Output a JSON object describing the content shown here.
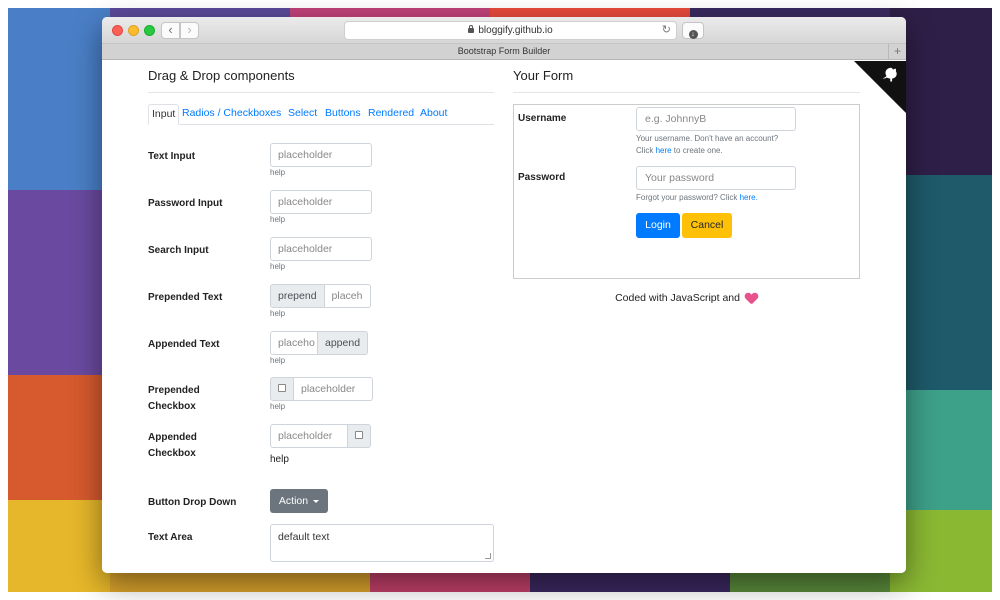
{
  "browser": {
    "url": "bloggify.github.io",
    "tab_title": "Bootstrap Form Builder",
    "back_label": "‹",
    "forward_label": "›",
    "reload_label": "↻",
    "download_label": "↓",
    "new_tab_label": "+"
  },
  "left": {
    "title": "Drag & Drop components",
    "tabs": [
      {
        "label": "Input",
        "active": true
      },
      {
        "label": "Radios / Checkboxes"
      },
      {
        "label": "Select"
      },
      {
        "label": "Buttons"
      },
      {
        "label": "Rendered"
      },
      {
        "label": "About"
      }
    ],
    "components": {
      "text_input": {
        "label": "Text Input",
        "placeholder": "placeholder",
        "help": "help"
      },
      "password_input": {
        "label": "Password Input",
        "placeholder": "placeholder",
        "help": "help"
      },
      "search_input": {
        "label": "Search Input",
        "placeholder": "placeholder",
        "help": "help"
      },
      "prepended_text": {
        "label": "Prepended Text",
        "prepend": "prepend",
        "placeholder": "placeh",
        "help": "help"
      },
      "appended_text": {
        "label": "Appended Text",
        "placeholder": "placeho",
        "append": "append",
        "help": "help"
      },
      "prepended_checkbox": {
        "label_1": "Prepended",
        "label_2": "Checkbox",
        "placeholder": "placeholder",
        "help": "help"
      },
      "appended_checkbox": {
        "label_1": "Appended",
        "label_2": "Checkbox",
        "placeholder": "placeholder",
        "help": "help"
      },
      "button_drop_down": {
        "label": "Button Drop Down",
        "button": "Action"
      },
      "text_area": {
        "label": "Text Area",
        "value": "default text"
      }
    }
  },
  "right": {
    "title": "Your Form",
    "username": {
      "label": "Username",
      "placeholder": "e.g. JohnnyB",
      "help_1": "Your username. Don't have an account?",
      "help_2_pre": "Click ",
      "help_2_link": "here",
      "help_2_post": " to create one."
    },
    "password": {
      "label": "Password",
      "placeholder": "Your password",
      "help_pre": "Forgot your password? Click ",
      "help_link": "here."
    },
    "login_label": "Login",
    "cancel_label": "Cancel",
    "footer": "Coded with JavaScript and"
  },
  "colors": {
    "primary": "#007bff",
    "warning": "#ffc107",
    "secondary": "#6c757d",
    "heart": "#e8528c"
  }
}
